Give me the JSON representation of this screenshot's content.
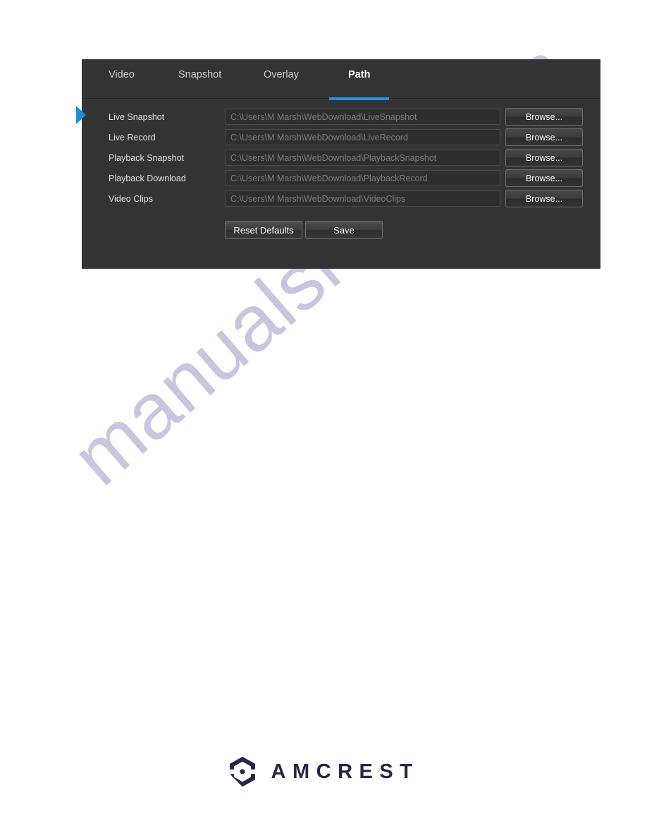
{
  "page": {
    "watermark_text": "manualshive.com",
    "background_color": "#ffffff"
  },
  "panel": {
    "background_color": "#333333",
    "accent_color": "#2196e8",
    "left_marker_icon": "blue-chevron-right-icon"
  },
  "tabs": [
    {
      "label": "Video",
      "active": false
    },
    {
      "label": "Snapshot",
      "active": false
    },
    {
      "label": "Overlay",
      "active": false
    },
    {
      "label": "Path",
      "active": true
    }
  ],
  "form": {
    "rows": [
      {
        "label": "Live Snapshot",
        "value": "C:\\Users\\M Marsh\\WebDownload\\LiveSnapshot",
        "button_label": "Browse..."
      },
      {
        "label": "Live Record",
        "value": "C:\\Users\\M Marsh\\WebDownload\\LiveRecord",
        "button_label": "Browse..."
      },
      {
        "label": "Playback Snapshot",
        "value": "C:\\Users\\M Marsh\\WebDownload\\PlaybackSnapshot",
        "button_label": "Browse..."
      },
      {
        "label": "Playback Download",
        "value": "C:\\Users\\M Marsh\\WebDownload\\PlaybackRecord",
        "button_label": "Browse..."
      },
      {
        "label": "Video Clips",
        "value": "C:\\Users\\M Marsh\\WebDownload\\VideoClips",
        "button_label": "Browse..."
      }
    ],
    "reset_label": "Reset Defaults",
    "save_label": "Save"
  },
  "footer": {
    "brand_name": "AMCREST",
    "logo_icon": "amcrest-hexagon-logo-icon",
    "brand_color": "#25264b"
  }
}
